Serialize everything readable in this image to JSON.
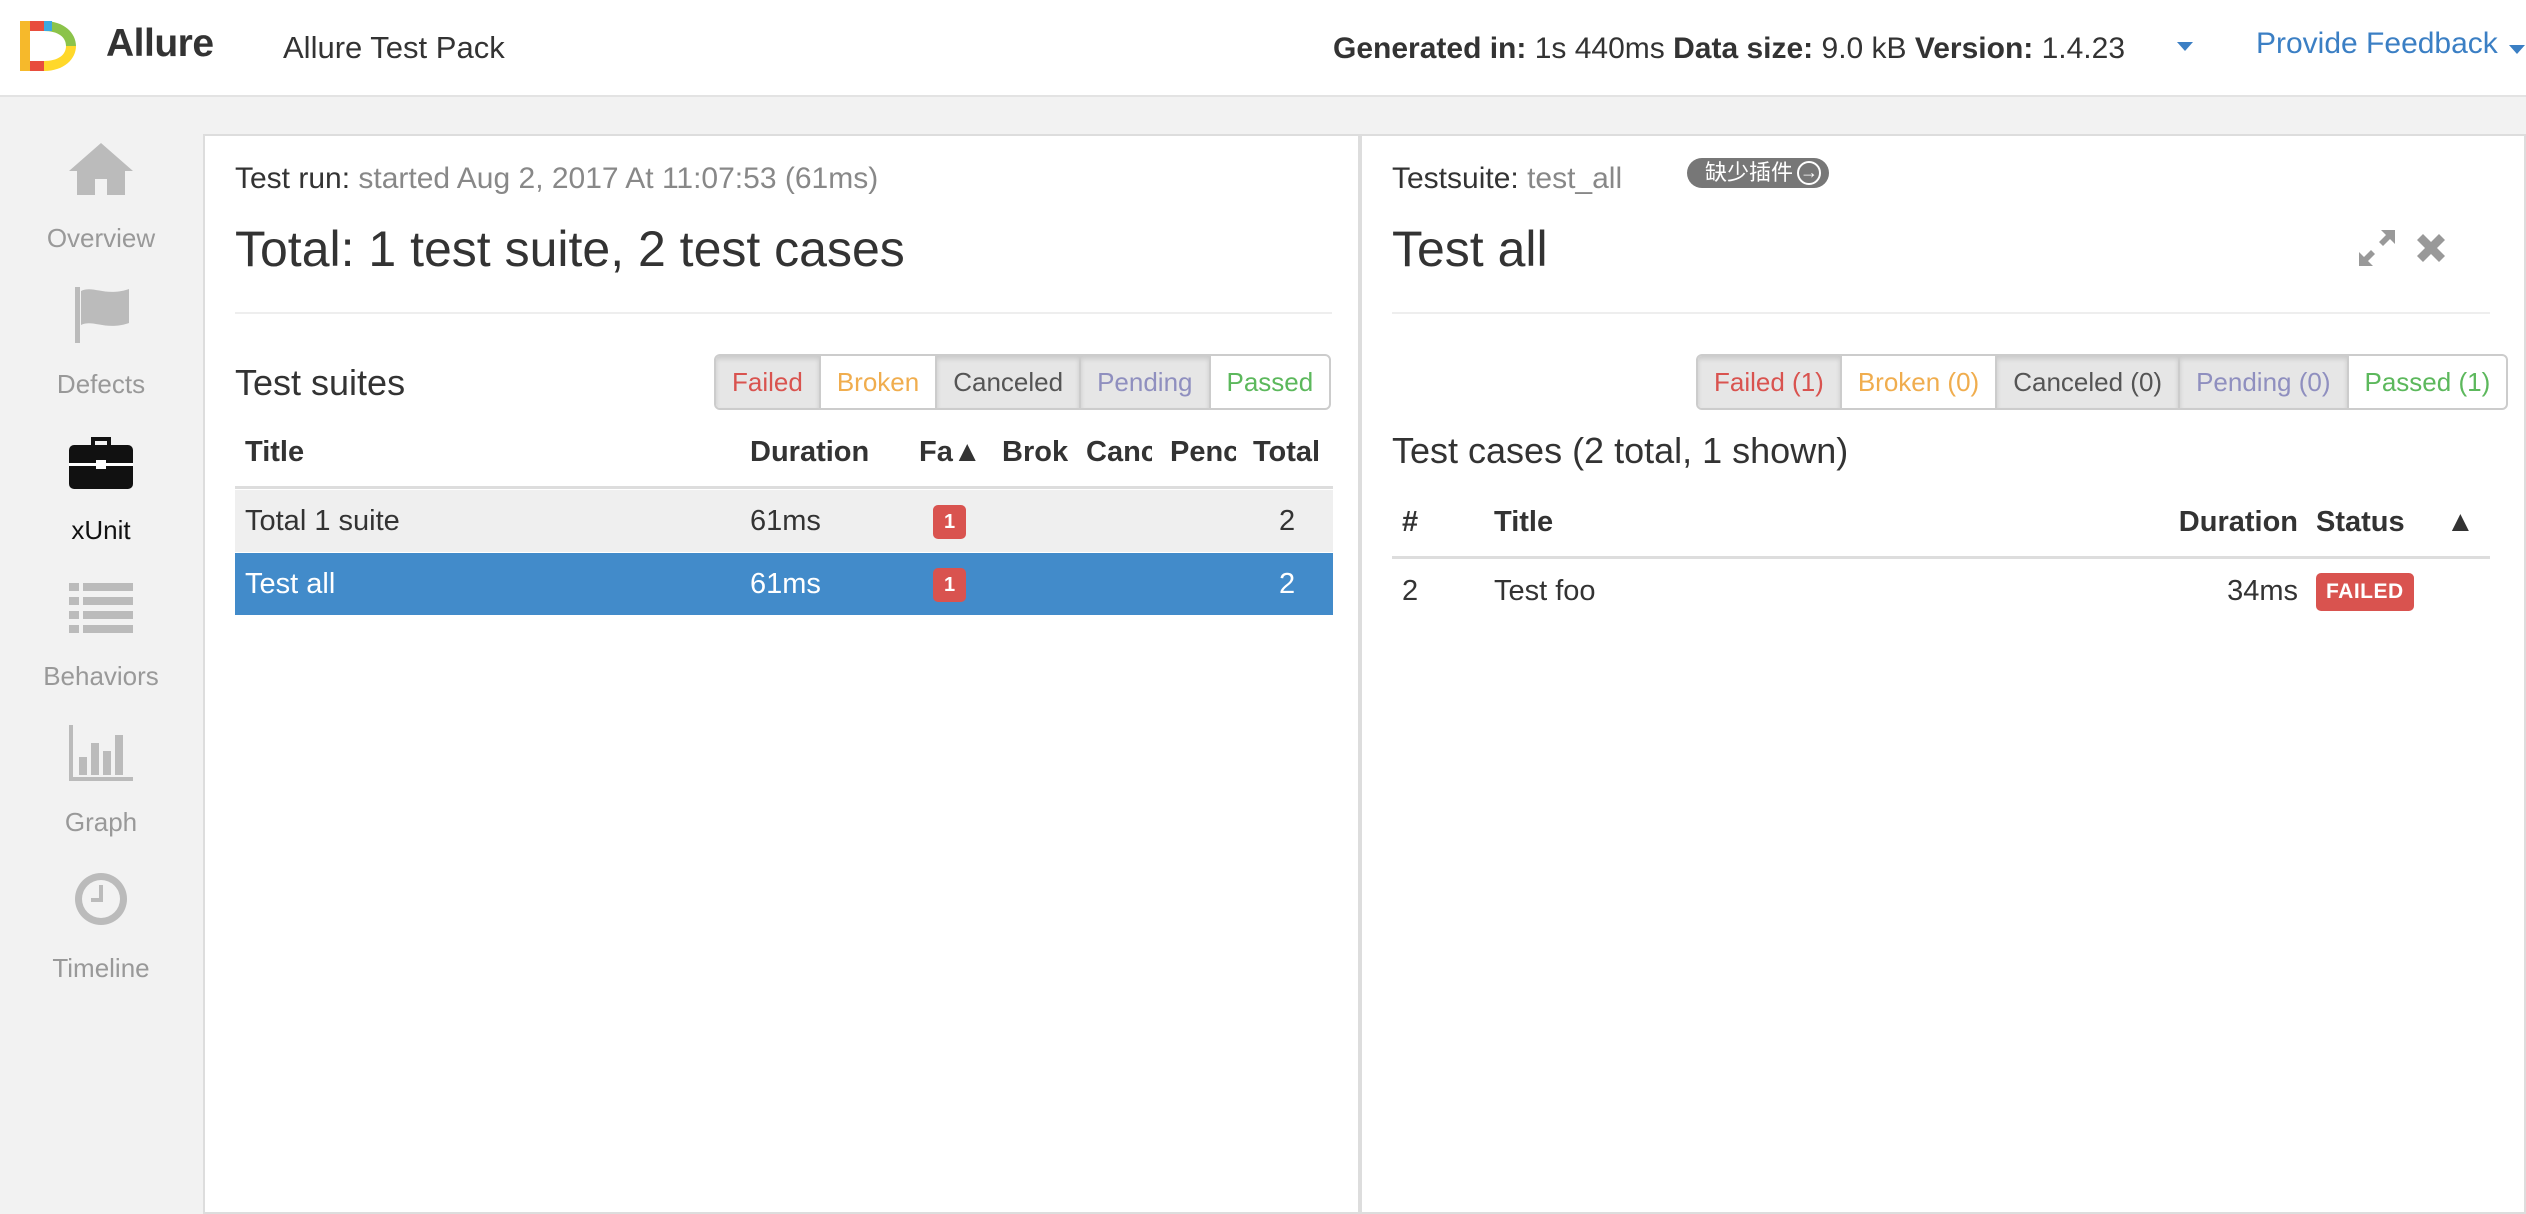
{
  "header": {
    "brand": "Allure",
    "report_name": "Allure Test Pack",
    "generated_label": "Generated in:",
    "generated_value": " 1s 440ms ",
    "datasize_label": "Data size:",
    "datasize_value": " 9.0 kB ",
    "version_label": " Version:",
    "version_value": " 1.4.23",
    "feedback": "Provide Feedback"
  },
  "sidebar": {
    "items": [
      {
        "label": "Overview",
        "icon": "home-icon",
        "active": false
      },
      {
        "label": "Defects",
        "icon": "flag-icon",
        "active": false
      },
      {
        "label": "xUnit",
        "icon": "briefcase-icon",
        "active": true
      },
      {
        "label": "Behaviors",
        "icon": "list-icon",
        "active": false
      },
      {
        "label": "Graph",
        "icon": "bar-chart-icon",
        "active": false
      },
      {
        "label": "Timeline",
        "icon": "clock-icon",
        "active": false
      }
    ]
  },
  "left": {
    "run_label": "Test run:",
    "run_value": " started Aug 2, 2017 At 11:07:53 (61ms)",
    "title": "Total: 1 test suite, 2 test cases",
    "section_title": "Test suites",
    "filters": [
      {
        "label": "Failed",
        "color": "#d9534f",
        "on": true
      },
      {
        "label": "Broken",
        "color": "#f0ad4e",
        "on": false
      },
      {
        "label": "Canceled",
        "color": "#555555",
        "on": true
      },
      {
        "label": "Pending",
        "color": "#8f8fbf",
        "on": true
      },
      {
        "label": "Passed",
        "color": "#5cb85c",
        "on": false
      }
    ],
    "columns": [
      "Title",
      "Duration",
      "Fa▲",
      "Brok",
      "Canc",
      "Penc",
      "Total"
    ],
    "rows": [
      {
        "title": "Total 1 suite",
        "duration": "61ms",
        "failed": "1",
        "total": "2"
      },
      {
        "title": "Test all",
        "duration": "61ms",
        "failed": "1",
        "total": "2"
      }
    ]
  },
  "right": {
    "suite_label": "Testsuite:",
    "suite_value": " test_all",
    "plugin_label": "缺少插件",
    "title": "Test all",
    "filters": [
      {
        "label": "Failed (1)",
        "color": "#d9534f",
        "on": true
      },
      {
        "label": "Broken (0)",
        "color": "#f0ad4e",
        "on": false
      },
      {
        "label": "Canceled (0)",
        "color": "#555555",
        "on": true
      },
      {
        "label": "Pending (0)",
        "color": "#8f8fbf",
        "on": true
      },
      {
        "label": "Passed (1)",
        "color": "#5cb85c",
        "on": false
      }
    ],
    "section_title": "Test cases (2 total, 1 shown)",
    "columns": [
      "#",
      "Title",
      "Duration",
      "Status",
      "▲"
    ],
    "rows": [
      {
        "num": "2",
        "title": "Test foo",
        "duration": "34ms",
        "status": "FAILED"
      }
    ]
  }
}
